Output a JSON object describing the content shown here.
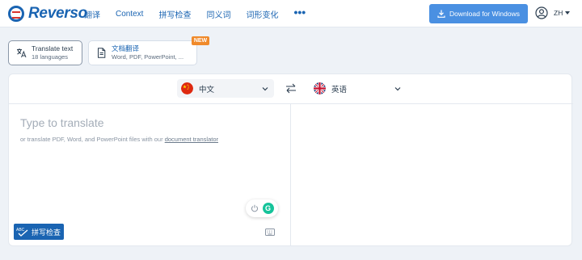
{
  "brand": {
    "name": "Reverso"
  },
  "nav": {
    "items": [
      "翻译",
      "Context",
      "拼写检查",
      "同义词",
      "词形变化"
    ],
    "more": "•••"
  },
  "header": {
    "download_label": "Download for Windows",
    "user_lang": "ZH"
  },
  "modes": {
    "text": {
      "title": "Translate text",
      "subtitle": "18 languages"
    },
    "document": {
      "title": "文档翻译",
      "subtitle": "Word, PDF, PowerPoint, ...",
      "badge": "NEW"
    }
  },
  "translator": {
    "source_lang": "中文",
    "target_lang": "英语",
    "source_flag_icon": "china-flag-icon",
    "target_flag_icon": "uk-flag-icon",
    "placeholder": "Type to translate",
    "hint_prefix": "or translate PDF, Word, and PowerPoint files with our ",
    "hint_link": "document translator"
  },
  "spellcheck": {
    "label": "拼写检查"
  },
  "colors": {
    "brand_blue": "#1a64b2",
    "button_blue": "#4a90e2",
    "badge_orange": "#f08a2b",
    "grammarly_green": "#15c39a"
  }
}
